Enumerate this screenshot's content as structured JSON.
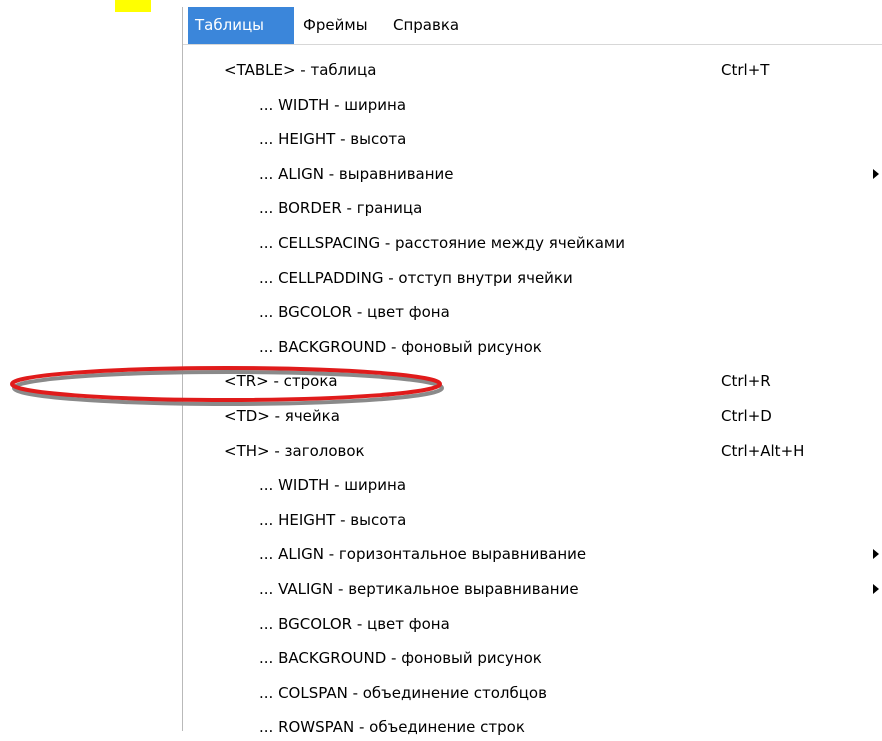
{
  "menubar": {
    "items": [
      {
        "label": "Таблицы",
        "active": true
      },
      {
        "label": "Фреймы",
        "active": false
      },
      {
        "label": "Справка",
        "active": false
      }
    ]
  },
  "menu": {
    "items": [
      {
        "label": "<TABLE> - таблица",
        "shortcut": "Ctrl+T",
        "level": 0,
        "submenu": false
      },
      {
        "label": "... WIDTH - ширина",
        "shortcut": "",
        "level": 1,
        "submenu": false
      },
      {
        "label": "... HEIGHT - высота",
        "shortcut": "",
        "level": 1,
        "submenu": false
      },
      {
        "label": "... ALIGN - выравнивание",
        "shortcut": "",
        "level": 1,
        "submenu": true
      },
      {
        "label": "... BORDER - граница",
        "shortcut": "",
        "level": 1,
        "submenu": false
      },
      {
        "label": "... CELLSPACING - расстояние между ячейками",
        "shortcut": "",
        "level": 1,
        "submenu": false
      },
      {
        "label": "... CELLPADDING - отступ внутри ячейки",
        "shortcut": "",
        "level": 1,
        "submenu": false
      },
      {
        "label": "... BGCOLOR - цвет фона",
        "shortcut": "",
        "level": 1,
        "submenu": false
      },
      {
        "label": "... BACKGROUND - фоновый рисунок",
        "shortcut": "",
        "level": 1,
        "submenu": false
      },
      {
        "label": "<TR> - строка",
        "shortcut": "Ctrl+R",
        "level": 0,
        "submenu": false
      },
      {
        "label": "<TD> - ячейка",
        "shortcut": "Ctrl+D",
        "level": 0,
        "submenu": false
      },
      {
        "label": "<TH> - заголовок",
        "shortcut": "Ctrl+Alt+H",
        "level": 0,
        "submenu": false
      },
      {
        "label": "... WIDTH - ширина",
        "shortcut": "",
        "level": 1,
        "submenu": false
      },
      {
        "label": "... HEIGHT - высота",
        "shortcut": "",
        "level": 1,
        "submenu": false
      },
      {
        "label": "... ALIGN - горизонтальное выравнивание",
        "shortcut": "",
        "level": 1,
        "submenu": true
      },
      {
        "label": "... VALIGN - вертикальное выравнивание",
        "shortcut": "",
        "level": 1,
        "submenu": true
      },
      {
        "label": "... BGCOLOR - цвет фона",
        "shortcut": "",
        "level": 1,
        "submenu": false
      },
      {
        "label": "... BACKGROUND - фоновый рисунок",
        "shortcut": "",
        "level": 1,
        "submenu": false
      },
      {
        "label": "... COLSPAN - объединение столбцов",
        "shortcut": "",
        "level": 1,
        "submenu": false
      },
      {
        "label": "... ROWSPAN - объединение строк",
        "shortcut": "",
        "level": 1,
        "submenu": false
      }
    ]
  },
  "colors": {
    "active_menu_bg": "#3b86da",
    "active_menu_text": "#ffffff",
    "annotation_ellipse": "#e01b1b",
    "annotation_shadow": "#8a8a8a",
    "highlight_mark": "#ffff00"
  },
  "icons": {
    "submenu": "submenu-arrow-icon"
  }
}
